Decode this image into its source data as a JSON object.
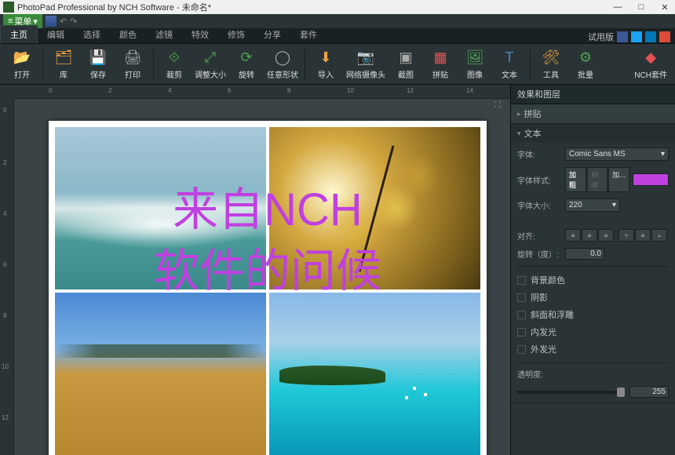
{
  "titlebar": {
    "title": "PhotoPad Professional by NCH Software - 未命名*"
  },
  "menubar": {
    "menu_label": "菜单"
  },
  "tabs": {
    "items": [
      "主页",
      "编辑",
      "选择",
      "颜色",
      "滤镜",
      "特效",
      "修饰",
      "分享",
      "套件"
    ],
    "trial_label": "试用版"
  },
  "ribbon": {
    "open": "打开",
    "library": "库",
    "save": "保存",
    "print": "打印",
    "crop": "裁剪",
    "resize": "调整大小",
    "rotate": "旋转",
    "shape": "任意形状",
    "import": "导入",
    "webcam": "网络摄像头",
    "screenshot": "截图",
    "collage": "拼贴",
    "image": "图像",
    "text": "文本",
    "tool": "工具",
    "batch": "批量",
    "nch": "NCH套件"
  },
  "rightpanel": {
    "header": "效果和图层",
    "section_collage": "拼贴",
    "section_text": "文本",
    "font_label": "字体:",
    "font_value": "Comic Sans MS",
    "style_label": "字体样式:",
    "style_bold": "加粗",
    "style_italic": "斜体",
    "style_more": "加...",
    "size_label": "字体大小:",
    "size_value": "220",
    "align_label": "对齐:",
    "rotate_label": "旋转（度）:",
    "rotate_value": "0.0",
    "cb_bgcolor": "背景颜色",
    "cb_shadow": "阴影",
    "cb_bevel": "斜面和浮雕",
    "cb_innerglow": "内发光",
    "cb_outerglow": "外发光",
    "opacity_label": "透明度:",
    "opacity_value": "255"
  },
  "canvas": {
    "overlay_line1": "来自NCH",
    "overlay_line2": "软件的问候"
  },
  "ruler": {
    "h_ticks": [
      "0",
      "2",
      "4",
      "6",
      "8",
      "10",
      "12",
      "14"
    ],
    "v_ticks": [
      "0",
      "2",
      "4",
      "6",
      "8",
      "10",
      "12"
    ]
  }
}
